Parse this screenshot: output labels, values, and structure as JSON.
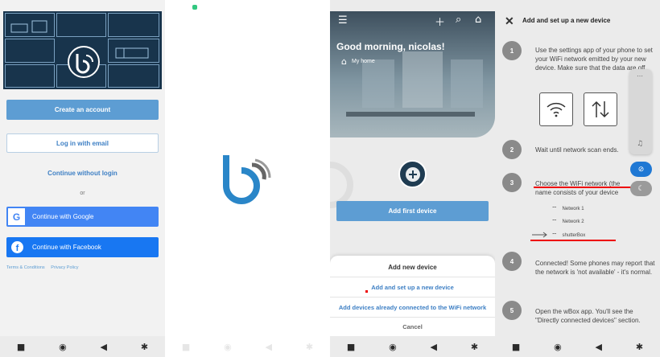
{
  "colors": {
    "brand_blue": "#5d9dd3",
    "google_blue": "#4285f4",
    "facebook_blue": "#1877f2",
    "accent_red": "#e00000"
  },
  "signup": {
    "create_account": "Create an account",
    "login_email": "Log in with email",
    "continue_without_login": "Continue without login",
    "or": "or",
    "google": "Continue with Google",
    "google_icon_letter": "G",
    "facebook": "Continue with Facebook",
    "facebook_icon_letter": "f",
    "terms": "Terms & Conditions",
    "privacy": "Privacy Policy"
  },
  "dashboard": {
    "greeting": "Good morning, nicolas!",
    "home_label": "My home",
    "add_first_device": "Add first device",
    "sheet": {
      "title": "Add new device",
      "option_new": "Add and set up a new device",
      "option_existing": "Add devices already connected to the WiFi network",
      "cancel": "Cancel"
    }
  },
  "setup": {
    "title": "Add and set up a new device",
    "steps": [
      {
        "num": "1",
        "text": "Use the settings app of your phone to set your WiFi network emitted by your new device. Make sure that the data are off."
      },
      {
        "num": "2",
        "text": "Wait until network scan ends."
      },
      {
        "num": "3",
        "text": "Choose the WiFi network (the name consists of your device type and"
      },
      {
        "num": "4",
        "text": "Connected! Some phones may report that the network is 'not available' - it's normal."
      },
      {
        "num": "5",
        "text": "Open the wBox app. You'll see the \"Directly connected devices\" section."
      }
    ],
    "networks": [
      "Network 1",
      "Network 2",
      "shutterBox"
    ]
  },
  "nav": {
    "square": "■",
    "home": "◉",
    "back": "◀",
    "accessibility": "✱"
  }
}
